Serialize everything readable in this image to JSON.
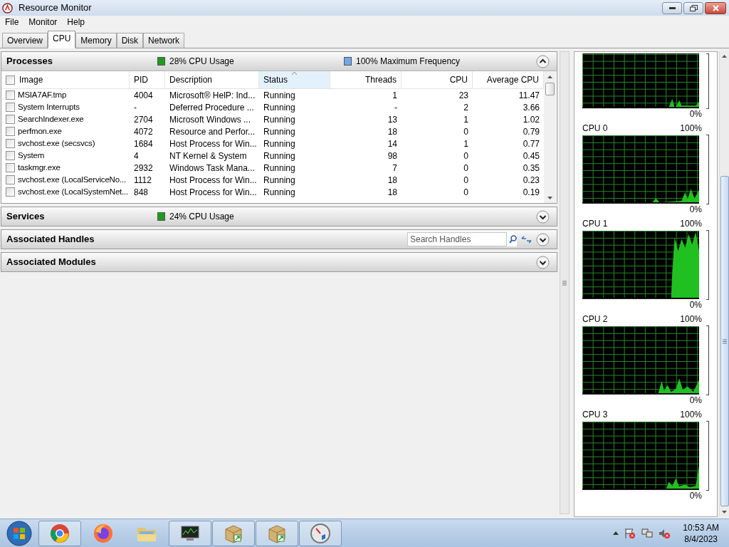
{
  "window": {
    "title": "Resource Monitor"
  },
  "menu": [
    "File",
    "Monitor",
    "Help"
  ],
  "tabs": [
    {
      "label": "Overview",
      "selected": false
    },
    {
      "label": "CPU",
      "selected": true
    },
    {
      "label": "Memory",
      "selected": false
    },
    {
      "label": "Disk",
      "selected": false
    },
    {
      "label": "Network",
      "selected": false
    }
  ],
  "sections": [
    {
      "kind": "table",
      "title": "Processes",
      "expanded": true,
      "badges": [
        {
          "text": "28% CPU Usage",
          "color": "#1c9c1c"
        },
        {
          "text": "100% Maximum Frequency",
          "color": "#6fa8ec"
        }
      ],
      "table": {
        "columns": [
          {
            "label": "Image",
            "sorted": false
          },
          {
            "label": "PID",
            "sorted": false
          },
          {
            "label": "Description",
            "sorted": false
          },
          {
            "label": "Status",
            "sorted": true
          },
          {
            "label": "Threads",
            "sorted": false
          },
          {
            "label": "CPU",
            "sorted": false
          },
          {
            "label": "Average CPU",
            "sorted": false
          }
        ],
        "rows": [
          {
            "checked": false,
            "cells": [
              "MSIA7AF.tmp",
              "4004",
              "Microsoft® HelP: Ind...",
              "Running",
              "1",
              "23",
              "11.47"
            ]
          },
          {
            "checked": false,
            "cells": [
              "System Interrupts",
              "-",
              "Deferred Procedure ...",
              "Running",
              "-",
              "2",
              "3.66"
            ]
          },
          {
            "checked": false,
            "cells": [
              "SearchIndexer.exe",
              "2704",
              "Microsoft Windows ...",
              "Running",
              "13",
              "1",
              "1.02"
            ]
          },
          {
            "checked": false,
            "cells": [
              "perfmon.exe",
              "4072",
              "Resource and Perfor...",
              "Running",
              "18",
              "0",
              "0.79"
            ]
          },
          {
            "checked": false,
            "cells": [
              "svchost.exe (secsvcs)",
              "1684",
              "Host Process for Win...",
              "Running",
              "14",
              "1",
              "0.77"
            ]
          },
          {
            "checked": false,
            "cells": [
              "System",
              "4",
              "NT Kernel & System",
              "Running",
              "98",
              "0",
              "0.45"
            ]
          },
          {
            "checked": false,
            "cells": [
              "taskmgr.exe",
              "2932",
              "Windows Task Mana...",
              "Running",
              "7",
              "0",
              "0.35"
            ]
          },
          {
            "checked": false,
            "cells": [
              "svchost.exe (LocalServiceNo...",
              "1112",
              "Host Process for Win...",
              "Running",
              "18",
              "0",
              "0.23"
            ]
          },
          {
            "checked": false,
            "cells": [
              "svchost.exe (LocalSystemNet...",
              "848",
              "Host Process for Win...",
              "Running",
              "18",
              "0",
              "0.19"
            ]
          }
        ]
      }
    },
    {
      "kind": "plain",
      "title": "Services",
      "expanded": false,
      "badges": [
        {
          "text": "24% CPU Usage",
          "color": "#1c9c1c"
        }
      ]
    },
    {
      "kind": "search",
      "title": "Associated Handles",
      "expanded": false,
      "placeholder": "Search Handles"
    },
    {
      "kind": "plain",
      "title": "Associated Modules",
      "expanded": false
    }
  ],
  "graphs": [
    {
      "min_label": "0%"
    },
    {
      "label": "CPU 0",
      "max_label": "100%",
      "min_label": "0%"
    },
    {
      "label": "CPU 1",
      "max_label": "100%",
      "min_label": "0%"
    },
    {
      "label": "CPU 2",
      "max_label": "100%",
      "min_label": "0%"
    },
    {
      "label": "CPU 3",
      "max_label": "100%",
      "min_label": "0%"
    }
  ],
  "taskbar": {
    "time": "10:53 AM",
    "date": "8/4/2023"
  }
}
